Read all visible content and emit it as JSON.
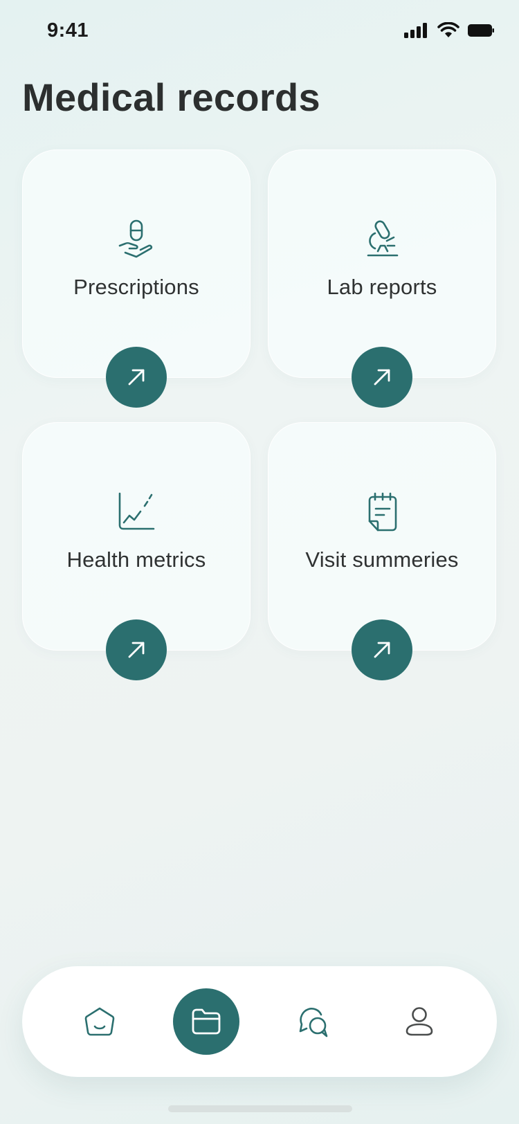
{
  "status_bar": {
    "time": "9:41",
    "icons": [
      "cellular-signal-icon",
      "wifi-icon",
      "battery-icon"
    ]
  },
  "header": {
    "title": "Medical records"
  },
  "cards": [
    {
      "label": "Prescriptions",
      "icon": "pill-in-hand-icon",
      "action_icon": "arrow-up-right-icon"
    },
    {
      "label": "Lab reports",
      "icon": "microscope-icon",
      "action_icon": "arrow-up-right-icon"
    },
    {
      "label": "Health metrics",
      "icon": "line-chart-icon",
      "action_icon": "arrow-up-right-icon"
    },
    {
      "label": "Visit summeries",
      "icon": "notepad-icon",
      "action_icon": "arrow-up-right-icon"
    }
  ],
  "bottom_nav": {
    "items": [
      {
        "name": "home",
        "icon": "home-icon",
        "active": false
      },
      {
        "name": "records",
        "icon": "folder-icon",
        "active": true
      },
      {
        "name": "chat",
        "icon": "chat-bubbles-icon",
        "active": false
      },
      {
        "name": "profile",
        "icon": "user-icon",
        "active": false
      }
    ]
  },
  "colors": {
    "accent": "#2b6f6f",
    "background": "#eaf3f2",
    "card": "#f4f9f9",
    "text": "#2c2f2f"
  }
}
